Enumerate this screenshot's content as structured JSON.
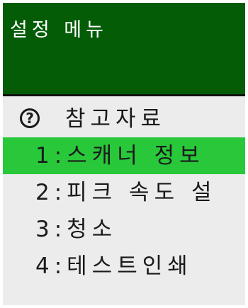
{
  "header": {
    "title": "설정 메뉴"
  },
  "menu": {
    "reference": {
      "icon": "help-circle-icon",
      "icon_glyph": "?",
      "label": "참고자료"
    },
    "items": [
      {
        "label": "1:스캐너 정보",
        "selected": true
      },
      {
        "label": "2:피크 속도 설",
        "selected": false
      },
      {
        "label": "3:청소",
        "selected": false
      },
      {
        "label": "4:테스트인쇄",
        "selected": false
      }
    ]
  },
  "colors": {
    "header_bg": "#045c07",
    "selected_bg": "#28c83a",
    "list_bg": "#ececec",
    "text": "#1a1a1a"
  }
}
